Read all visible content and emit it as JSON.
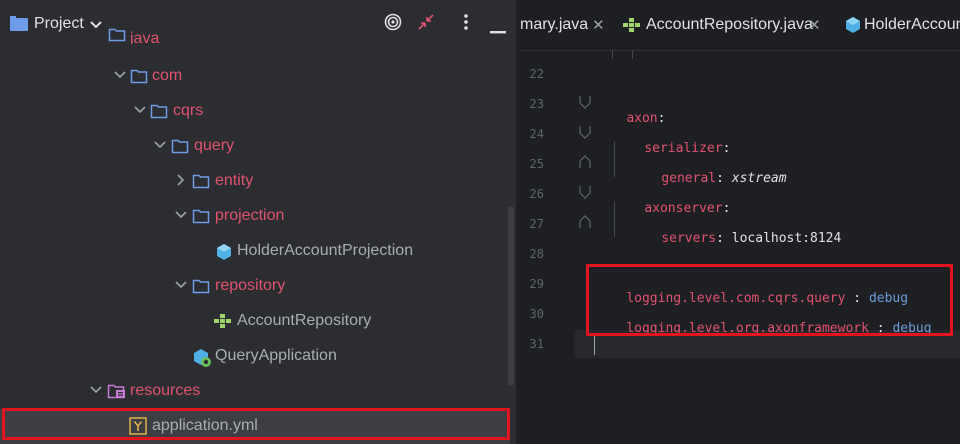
{
  "project_panel": {
    "title": "Project",
    "tree": [
      {
        "label": "java",
        "kind": "folder",
        "expanded": true
      },
      {
        "label": "com",
        "kind": "package",
        "expanded": true
      },
      {
        "label": "cqrs",
        "kind": "package",
        "expanded": true
      },
      {
        "label": "query",
        "kind": "package",
        "expanded": true
      },
      {
        "label": "entity",
        "kind": "package",
        "expanded": false
      },
      {
        "label": "projection",
        "kind": "package",
        "expanded": true
      },
      {
        "label": "HolderAccountProjection",
        "kind": "class"
      },
      {
        "label": "repository",
        "kind": "package",
        "expanded": true
      },
      {
        "label": "AccountRepository",
        "kind": "interface"
      },
      {
        "label": "QueryApplication",
        "kind": "spring-boot-class"
      },
      {
        "label": "resources",
        "kind": "resources-folder",
        "expanded": true
      },
      {
        "label": "application.yml",
        "kind": "yaml-file",
        "selected": true
      }
    ]
  },
  "editor": {
    "tabs": [
      {
        "label": "mary.java",
        "icon": "class-icon"
      },
      {
        "label": "AccountRepository.java",
        "icon": "interface-icon"
      },
      {
        "label": "HolderAccoun",
        "icon": "class-icon"
      }
    ],
    "line_numbers": [
      "22",
      "23",
      "24",
      "25",
      "26",
      "27",
      "28",
      "29",
      "30",
      "31"
    ],
    "code": {
      "axon_key": "axon",
      "serializer_key": "serializer",
      "general_key": "general",
      "general_value": "xstream",
      "axonserver_key": "axonserver",
      "servers_key": "servers",
      "servers_value": "localhost:8124",
      "logging_1_key": "logging.level.com.cqrs.query",
      "logging_1_value": "debug",
      "logging_2_key": "logging.level.org.axonframework",
      "logging_2_value": "debug",
      "colon": ":",
      "sep": " : "
    }
  },
  "colors": {
    "highlight": "#e3141e",
    "package_text": "#e05270",
    "folder_icon": "#6f9ce8"
  }
}
